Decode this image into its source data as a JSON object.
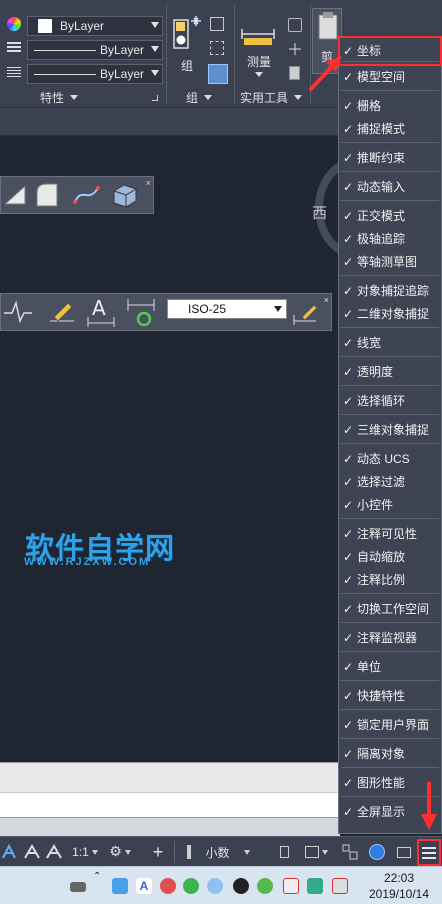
{
  "ribbon": {
    "layer_dropdown_1": "ByLayer",
    "layer_dropdown_2": "ByLayer",
    "layer_dropdown_3": "ByLayer",
    "panels": {
      "properties": "特性",
      "group": "组",
      "utilities": "实用工具"
    },
    "group_button": "组",
    "measure_button": "测量",
    "clipboard_button": "剪"
  },
  "viewport": {
    "compass_label": "西",
    "dim_style_value": "ISO-25"
  },
  "watermark": {
    "title": "软件自学网",
    "url": "WWW.RJZXW.COM"
  },
  "statusbar": {
    "scale": "1:1",
    "units": "小数"
  },
  "taskbar": {
    "time": "22:03",
    "date": "2019/10/14"
  },
  "menu": {
    "items": [
      {
        "label": "坐标",
        "checked": true
      },
      {
        "label": "模型空间",
        "checked": true
      },
      {
        "label": "栅格",
        "checked": true
      },
      {
        "label": "捕捉模式",
        "checked": true
      },
      {
        "label": "推断约束",
        "checked": true
      },
      {
        "label": "动态输入",
        "checked": true
      },
      {
        "label": "正交模式",
        "checked": true
      },
      {
        "label": "极轴追踪",
        "checked": true
      },
      {
        "label": "等轴测草图",
        "checked": true
      },
      {
        "label": "对象捕捉追踪",
        "checked": true
      },
      {
        "label": "二维对象捕捉",
        "checked": true
      },
      {
        "label": "线宽",
        "checked": true
      },
      {
        "label": "透明度",
        "checked": true
      },
      {
        "label": "选择循环",
        "checked": true
      },
      {
        "label": "三维对象捕捉",
        "checked": true
      },
      {
        "label": "动态 UCS",
        "checked": true
      },
      {
        "label": "选择过滤",
        "checked": true
      },
      {
        "label": "小控件",
        "checked": true
      },
      {
        "label": "注释可见性",
        "checked": true
      },
      {
        "label": "自动缩放",
        "checked": true
      },
      {
        "label": "注释比例",
        "checked": true
      },
      {
        "label": "切换工作空间",
        "checked": true
      },
      {
        "label": "注释监视器",
        "checked": true
      },
      {
        "label": "单位",
        "checked": true
      },
      {
        "label": "快捷特性",
        "checked": true
      },
      {
        "label": "锁定用户界面",
        "checked": true
      },
      {
        "label": "隔离对象",
        "checked": true
      },
      {
        "label": "图形性能",
        "checked": true
      },
      {
        "label": "全屏显示",
        "checked": true
      }
    ]
  },
  "colors": {
    "highlight": "#ff2f2f",
    "watermark": "#2fa3e6",
    "canvas": "#1f2531"
  }
}
